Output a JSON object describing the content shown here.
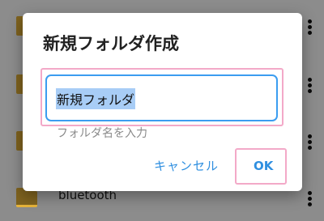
{
  "background_list": {
    "visible_item_label": "bluetooth"
  },
  "dialog": {
    "title": "新規フォルダ作成",
    "input_value": "新規フォルダ",
    "input_hint": "フォルダ名を入力",
    "cancel_label": "キャンセル",
    "ok_label": "OK"
  },
  "colors": {
    "accent": "#2f8fe0",
    "input_border": "#3b9df0",
    "selection": "#a8cdf6",
    "highlight_box": "#f3a9c8",
    "folder": "#e7b43a"
  }
}
